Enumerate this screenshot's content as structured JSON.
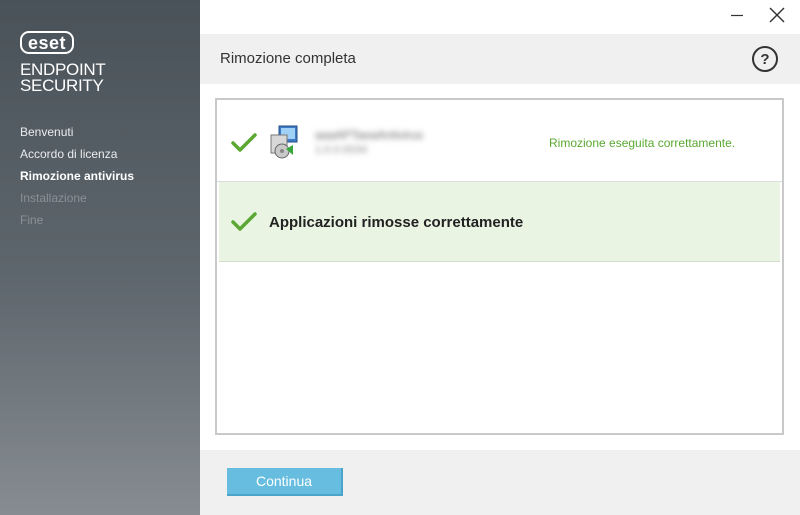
{
  "sidebar": {
    "logo_text": "eset",
    "product_name_line1": "ENDPOINT",
    "product_name_line2": "SECURITY",
    "steps": [
      {
        "label": "Benvenuti",
        "state": "done"
      },
      {
        "label": "Accordo di licenza",
        "state": "done"
      },
      {
        "label": "Rimozione antivirus",
        "state": "active"
      },
      {
        "label": "Installazione",
        "state": "disabled"
      },
      {
        "label": "Fine",
        "state": "disabled"
      }
    ]
  },
  "header": {
    "title": "Rimozione completa",
    "help_label": "?"
  },
  "results": {
    "app_row": {
      "name": "aaaAPTaeaAntivirus",
      "version": "1.0.0.0034",
      "status": "Rimozione eseguita correttamente."
    },
    "summary": "Applicazioni rimosse correttamente"
  },
  "footer": {
    "continue_label": "Continua"
  },
  "colors": {
    "accent_green": "#5aa832",
    "button_blue": "#66bde0",
    "success_row_bg": "#eaf4e3"
  }
}
